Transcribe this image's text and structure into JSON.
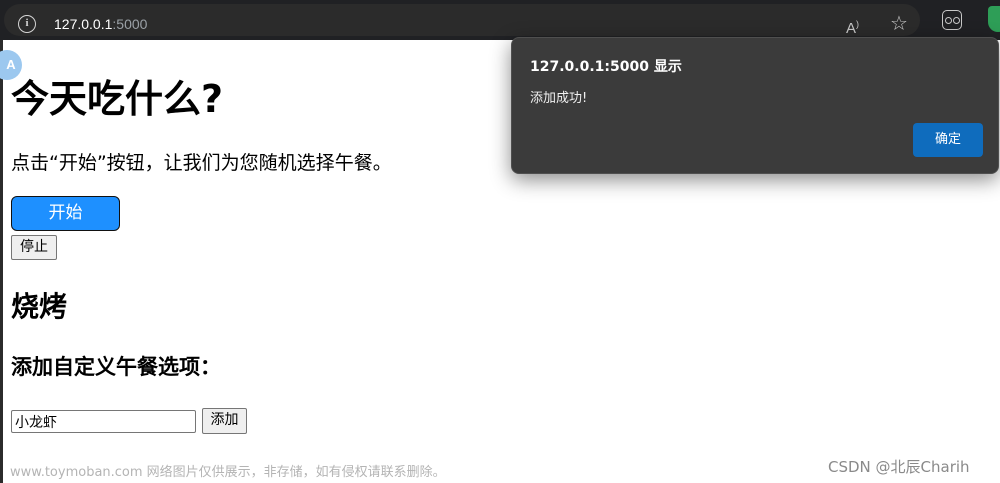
{
  "browser": {
    "url_host": "127.0.0.1",
    "url_port": ":5000",
    "avatar_letter": "A"
  },
  "page": {
    "title": "今天吃什么?",
    "instruction": "点击“开始”按钮，让我们为您随机选择午餐。",
    "start_label": "开始",
    "stop_label": "停止",
    "result": "烧烤",
    "add_heading": "添加自定义午餐选项：",
    "input_value": "小龙虾",
    "add_label": "添加"
  },
  "dialog": {
    "title": "127.0.0.1:5000 显示",
    "message": "添加成功!",
    "ok_label": "确定"
  },
  "overlay": {
    "watermark": "www.toymoban.com 网络图片仅供展示，非存储，如有侵权请联系删除。",
    "credit": "CSDN @北辰Charih"
  },
  "colors": {
    "start_button": "#1e90ff",
    "dialog_bg": "#3b3b3b",
    "dialog_ok": "#0f6cbd",
    "browser_bar": "#202124"
  }
}
